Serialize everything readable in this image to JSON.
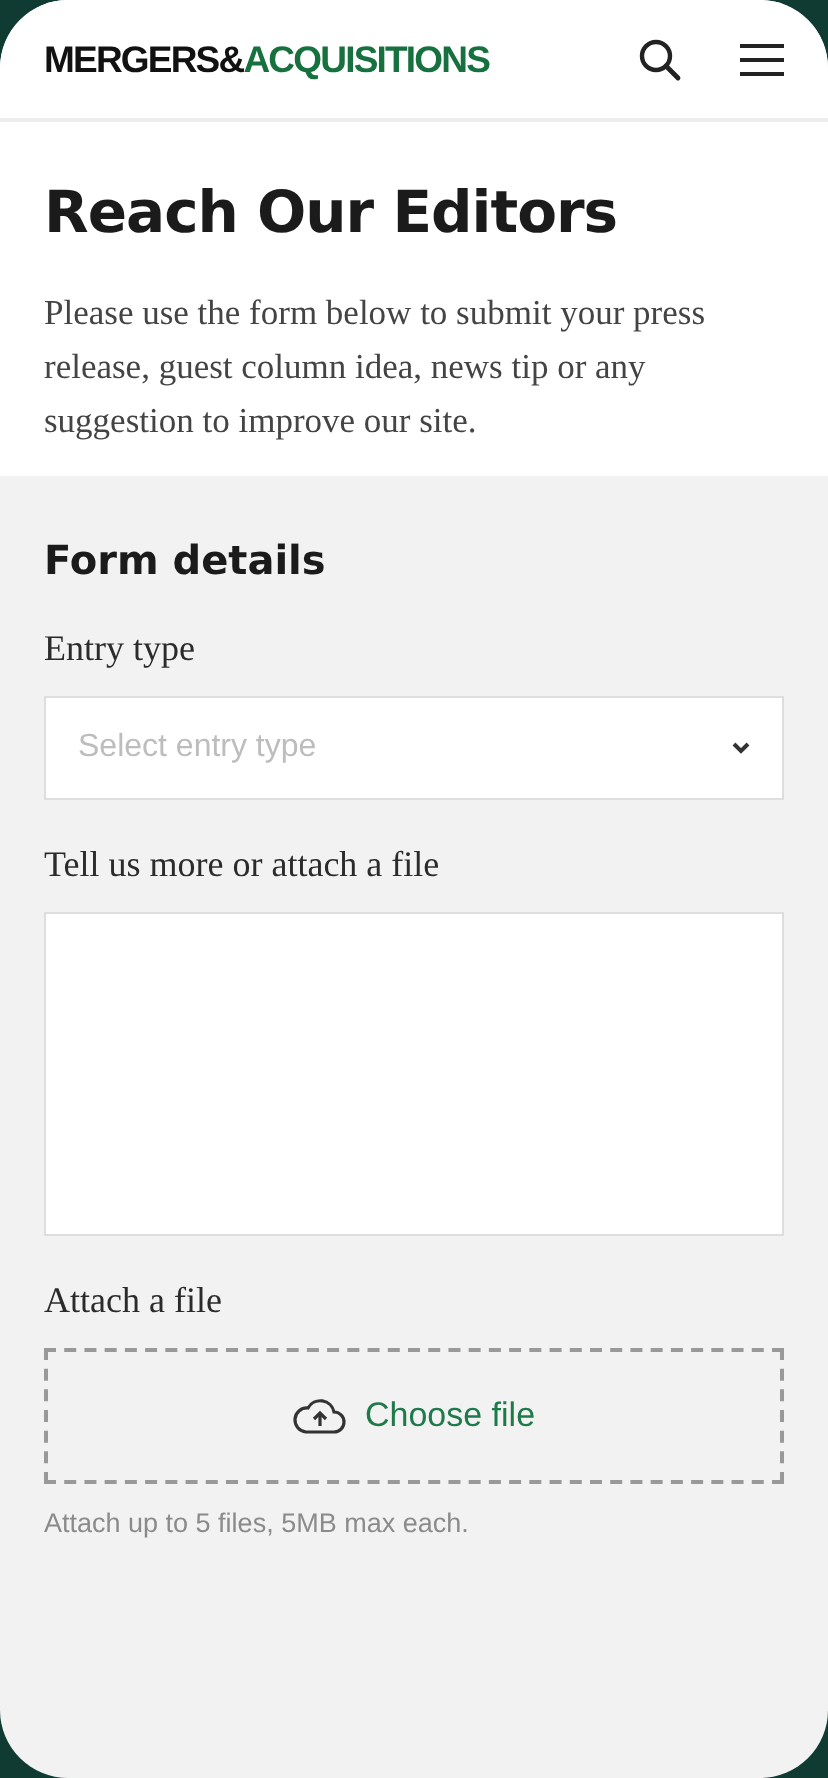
{
  "header": {
    "logo": [
      {
        "text": "MERGERS&",
        "color": "#111111"
      },
      {
        "text": "ACQUISITIONS",
        "color": "#17713f"
      }
    ]
  },
  "title": "Reach Our Editors",
  "intro": "Please use the form below to submit your press release, guest column idea, news tip or any suggestion to improve our site.",
  "form": {
    "heading": "Form details",
    "fields": [
      {
        "kind": "select",
        "label": "Entry type",
        "placeholder": "Select entry type"
      },
      {
        "kind": "textarea",
        "label": "Tell us more or attach a file"
      },
      {
        "kind": "file",
        "label": "Attach a file",
        "button": "Choose file",
        "hint": "Attach up to 5 files, 5MB max each."
      }
    ]
  }
}
